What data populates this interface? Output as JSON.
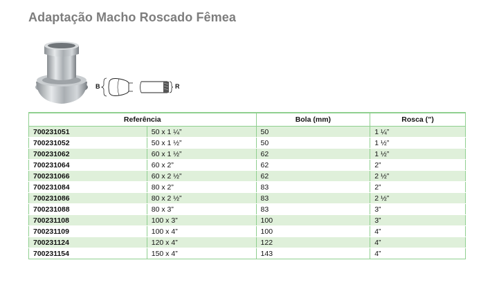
{
  "title": "Adaptação Macho Roscado Fêmea",
  "diagram": {
    "label_b": "B",
    "label_r": "R"
  },
  "table": {
    "headers": {
      "referencia": "Referência",
      "bola": "Bola (mm)",
      "rosca": "Rosca (”)"
    },
    "rows": [
      {
        "ref": "700231051",
        "size": "50 x 1 ¼”",
        "bola": "50",
        "rosca": "1 ¼”"
      },
      {
        "ref": "700231052",
        "size": "50 x 1 ½”",
        "bola": "50",
        "rosca": "1 ½”"
      },
      {
        "ref": "700231062",
        "size": "60 x 1 ½”",
        "bola": "62",
        "rosca": "1 ½”"
      },
      {
        "ref": "700231064",
        "size": "60 x 2”",
        "bola": "62",
        "rosca": "2”"
      },
      {
        "ref": "700231066",
        "size": "60 x 2 ½”",
        "bola": "62",
        "rosca": "2 ½”"
      },
      {
        "ref": "700231084",
        "size": "80 x 2”",
        "bola": "83",
        "rosca": "2”"
      },
      {
        "ref": "700231086",
        "size": "80 x 2 ½”",
        "bola": "83",
        "rosca": "2 ½”"
      },
      {
        "ref": "700231088",
        "size": "80 x 3”",
        "bola": "83",
        "rosca": "3”"
      },
      {
        "ref": "700231108",
        "size": "100 x 3”",
        "bola": "100",
        "rosca": "3”"
      },
      {
        "ref": "700231109",
        "size": "100 x 4”",
        "bola": "100",
        "rosca": "4”"
      },
      {
        "ref": "700231124",
        "size": "120 x 4”",
        "bola": "122",
        "rosca": "4”"
      },
      {
        "ref": "700231154",
        "size": "150 x 4”",
        "bola": "143",
        "rosca": "4”"
      }
    ]
  },
  "colors": {
    "title": "#7d7d7d",
    "row_stripe": "#dff0da",
    "border": "#8fcf8f"
  }
}
